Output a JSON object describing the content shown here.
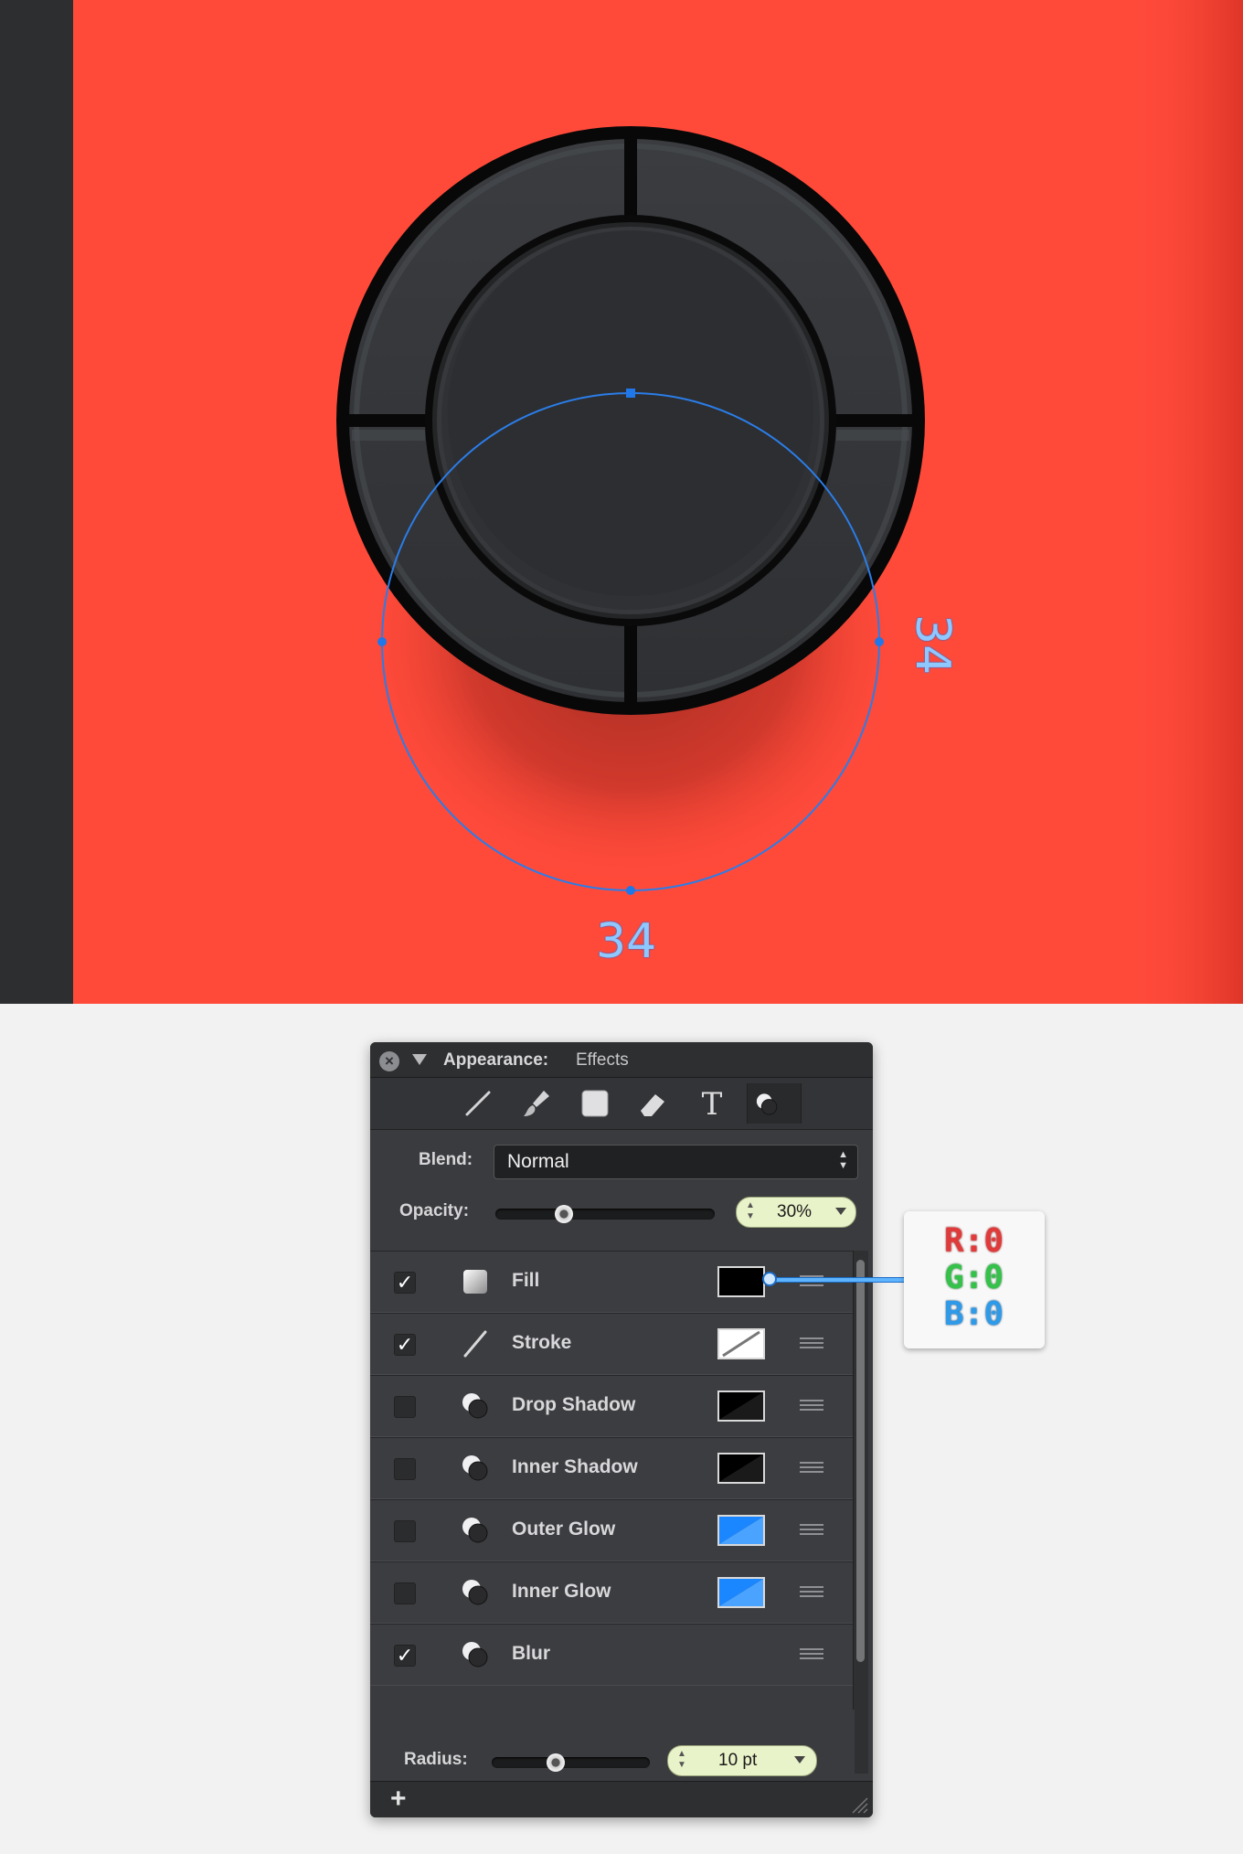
{
  "canvas": {
    "dim_bottom": "34",
    "dim_right": "34",
    "colors": {
      "background": "#ff4a3a",
      "left_bar": "#2c2e30",
      "guide": "#2b7de8"
    }
  },
  "panel": {
    "title": "Appearance:",
    "subtitle": "Effects",
    "close_icon": "×",
    "tools": [
      "line-tool-icon",
      "brush-tool-icon",
      "shape-tool-icon",
      "eraser-tool-icon",
      "text-tool-icon",
      "effects-tool-icon"
    ],
    "text_tool_glyph": "T",
    "blend_label": "Blend:",
    "blend_value": "Normal",
    "opacity_label": "Opacity:",
    "opacity_value": "30%",
    "opacity_level": 0.3,
    "rows": [
      {
        "name": "Fill",
        "checked": true,
        "check": "✓",
        "icon": "fill-icon",
        "swatch": "black"
      },
      {
        "name": "Stroke",
        "checked": true,
        "check": "✓",
        "icon": "stroke-icon",
        "swatch": "none"
      },
      {
        "name": "Drop Shadow",
        "checked": false,
        "check": "",
        "icon": "effect-icon",
        "swatch": "black-diagonal"
      },
      {
        "name": "Inner Shadow",
        "checked": false,
        "check": "",
        "icon": "effect-icon",
        "swatch": "black-diagonal"
      },
      {
        "name": "Outer Glow",
        "checked": false,
        "check": "",
        "icon": "effect-icon",
        "swatch": "blue-diagonal"
      },
      {
        "name": "Inner Glow",
        "checked": false,
        "check": "",
        "icon": "effect-icon",
        "swatch": "blue-diagonal"
      },
      {
        "name": "Blur",
        "checked": true,
        "check": "✓",
        "icon": "effect-icon",
        "swatch": ""
      }
    ],
    "radius_label": "Radius:",
    "radius_value": "10 pt",
    "add_label": "+"
  },
  "callout": {
    "r": "R:0",
    "g": "G:0",
    "b": "B:0"
  }
}
